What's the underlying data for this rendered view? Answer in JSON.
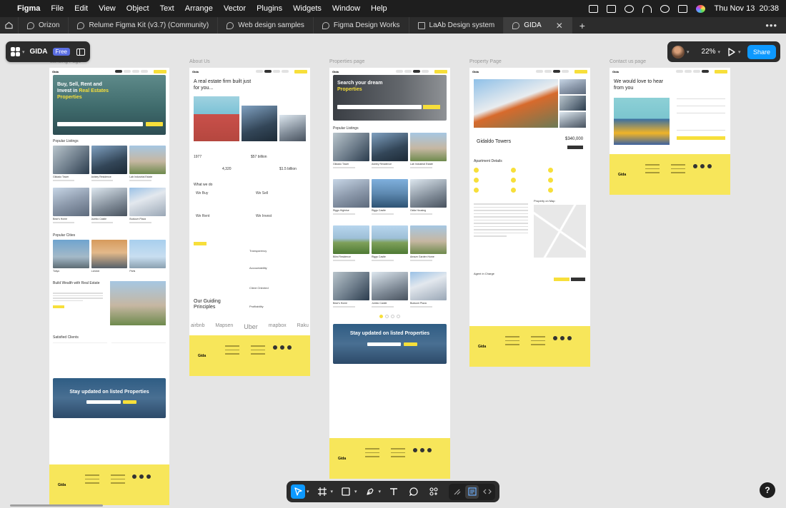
{
  "menubar": {
    "app": "Figma",
    "items": [
      "File",
      "Edit",
      "View",
      "Object",
      "Text",
      "Arrange",
      "Vector",
      "Plugins",
      "Widgets",
      "Window",
      "Help"
    ],
    "clock": "Thu Nov 13  20:38"
  },
  "tabs": [
    {
      "label": "Orizon",
      "active": false
    },
    {
      "label": "Relume Figma Kit (v3.7) (Community)",
      "active": false
    },
    {
      "label": "Web design samples",
      "active": false
    },
    {
      "label": "Figma Design Works",
      "active": false
    },
    {
      "label": "LaAb Design system",
      "active": false
    },
    {
      "label": "GIDA",
      "active": true
    }
  ],
  "file": {
    "name": "GIDA",
    "plan": "Free"
  },
  "right_toolbar": {
    "zoom": "22%",
    "share": "Share"
  },
  "canvas": {
    "frames": [
      {
        "label": "Landing Page"
      },
      {
        "label": "About Us"
      },
      {
        "label": "Properties page"
      },
      {
        "label": "Property Page"
      },
      {
        "label": "Contact us page"
      }
    ],
    "landing": {
      "brand": "Gida",
      "hero_title": "Buy, Sell, Rent and Invest in",
      "hero_accent": "Real Estates Properties",
      "popular": "Popular Listings",
      "listing_names": [
        "Gildado Tower",
        "Ashley Residence",
        "Lab Industrial Estate",
        "Bear's Home",
        "Jumbo Castle",
        "Buduum Plaza"
      ],
      "cities_title": "Popular Cities",
      "cities": [
        "Tokyo",
        "London",
        "Paris"
      ],
      "wealth": "Build Wealth with Real Estate",
      "clients": "Satisfied Clients",
      "subscribe": "Stay updated on listed Properties",
      "footer_logo": "Gida"
    },
    "about": {
      "title": "A real estate firm built just for you...",
      "stat_year": "1977",
      "stat_value": "$57 billion",
      "stat_count": "4,320",
      "stat_small": "$1.5 billion",
      "what": "What we do",
      "services": [
        "We Buy",
        "We Sell",
        "We Rent",
        "We Invest"
      ],
      "values": [
        "Transparency",
        "Accountability",
        "Client Oriented",
        "Profitability"
      ],
      "principles": "Our Guiding Principles",
      "logos": [
        "airbnb",
        "Mapsen",
        "Uber",
        "mapbox",
        "Raku"
      ],
      "footer_logo": "Gida"
    },
    "properties": {
      "hero_title": "Search your dream",
      "hero_accent": "Properties",
      "popular": "Popular Listings",
      "names": [
        "Gildado Tower",
        "Ashley Residence",
        "Lab Industrial Estate",
        "Riggs Highrise",
        "Riggs Castle",
        "Gidia Housing",
        "Bilini Residence",
        "Riggs Castle",
        "Amazn Garden Home",
        "Bear's Home",
        "Jumbo Castle",
        "Buduum Plaza"
      ],
      "subscribe": "Stay updated on listed Properties",
      "footer_logo": "Gida"
    },
    "property": {
      "name": "Gidaldo Towers",
      "price": "$340,000",
      "details": "Apartment Details",
      "map_title": "Property on Map",
      "agent": "Agent in Charge",
      "footer_logo": "Gida"
    },
    "contact": {
      "title": "We would love to hear from you",
      "footer_logo": "Gida"
    }
  },
  "bottom_toolbar": {
    "tools": [
      "move-tool",
      "frame-tool",
      "shape-tool",
      "pen-tool",
      "text-tool",
      "comment-tool",
      "actions-tool"
    ],
    "modes": [
      "draw-mode",
      "design-mode",
      "dev-mode"
    ]
  },
  "colors": {
    "accent": "#0d99ff",
    "brand_yellow": "#f7e65a",
    "toolbar": "#2c2c2c",
    "canvas": "#e5e5e5"
  }
}
